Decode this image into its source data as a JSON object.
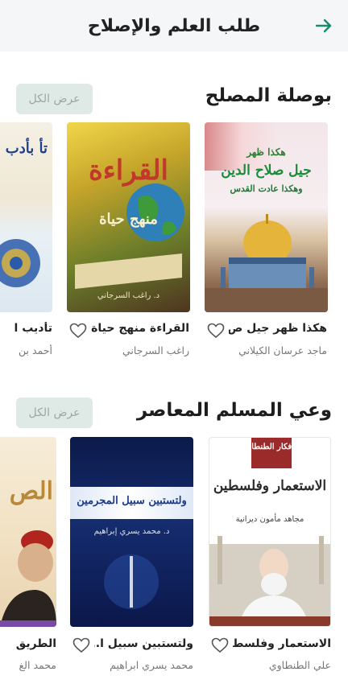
{
  "header": {
    "title": "طلب العلم والإصلاح",
    "back_icon": "arrow-right-icon",
    "accent_color": "#1a8a6b"
  },
  "sections": [
    {
      "title": "بوصلة المصلح",
      "view_all": "عرض الكل",
      "books": [
        {
          "title": "هكذا ظهر جيل ص...",
          "author": "ماجد عرسان الكيلاني",
          "cover_title": "جيل صلاح الدين",
          "cover_top": "هكذا ظهر",
          "cover_sub": "وهكذا عادت القدس"
        },
        {
          "title": "القراءة منهج حياة",
          "author": "راغب السرجاني",
          "cover_title": "القراءة",
          "cover_sub": "منهج حياة",
          "cover_author": "د. راغب السرجاني"
        },
        {
          "title": "تأديب ا",
          "author": "أحمد بن",
          "cover_title": "تأ بأدب"
        }
      ]
    },
    {
      "title": "وعي المسلم المعاصر",
      "view_all": "عرض الكل",
      "books": [
        {
          "title": "الاستعمار وفلسط...",
          "author": "علي الطنطاوي",
          "cover_top": "الأفكار الطنطاوية",
          "cover_title": "الاستعمار وفلسطين",
          "cover_author": "مجاهد مأمون ديرانية"
        },
        {
          "title": "ولتستبين سبيل ا...",
          "author": "محمد يسري ابراهيم",
          "cover_title": "ولتستبين سبيل المجرمين",
          "cover_author": "د. محمد يسري إبراهيم"
        },
        {
          "title": "الطريق",
          "author": "محمد الغ",
          "cover_title": "الص"
        }
      ]
    }
  ]
}
